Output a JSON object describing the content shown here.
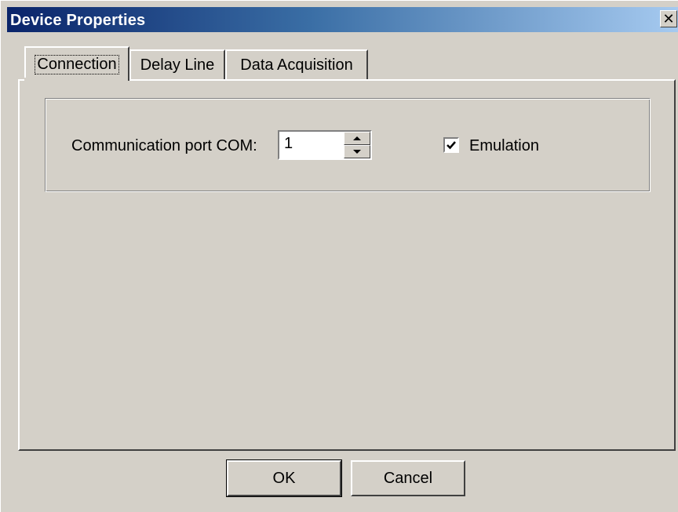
{
  "window": {
    "title": "Device Properties",
    "close_glyph": "✕"
  },
  "tabs": [
    {
      "label": "Connection",
      "active": true
    },
    {
      "label": "Delay Line",
      "active": false
    },
    {
      "label": "Data Acquisition",
      "active": false
    }
  ],
  "connection": {
    "port_label": "Communication port COM:",
    "port_value": "1",
    "emulation_label": "Emulation",
    "emulation_checked": true
  },
  "buttons": {
    "ok_label": "OK",
    "cancel_label": "Cancel"
  }
}
